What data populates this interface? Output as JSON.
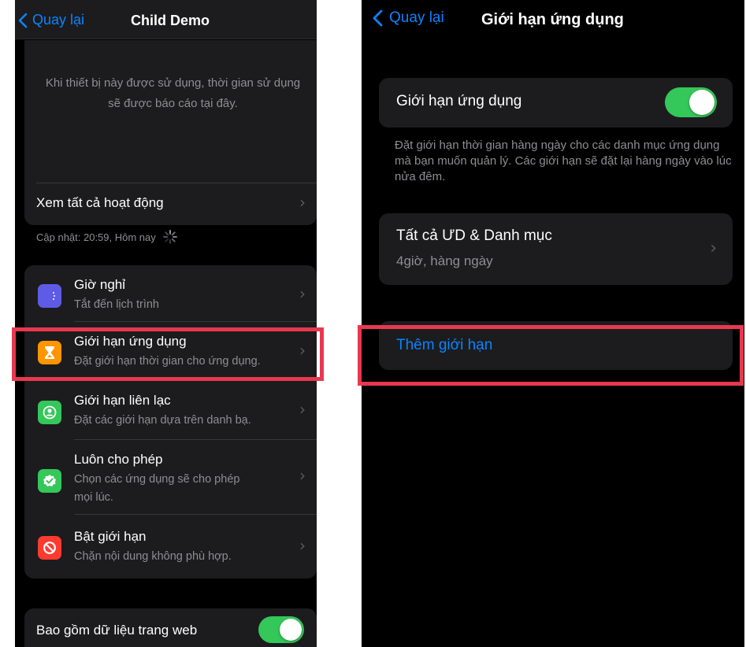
{
  "left_screen": {
    "nav": {
      "back_label": "Quay lại",
      "title": "Child Demo"
    },
    "usage_notice": "Khi thiết bị này được sử dụng, thời gian sử dụng sẽ được báo cáo tại đây.",
    "see_all_activity": "Xem tất cả hoạt động",
    "updated_text": "Cập nhật: 20:59, Hôm nay",
    "settings": [
      {
        "title": "Giờ nghỉ",
        "subtitle": "Tắt đến lịch trình",
        "icon": "downtime-icon",
        "color": "#5e5ce6"
      },
      {
        "title": "Giới hạn ứng dụng",
        "subtitle": "Đặt giới hạn thời gian cho ứng dụng.",
        "icon": "hourglass-icon",
        "color": "#ff9500"
      },
      {
        "title": "Giới hạn liên lạc",
        "subtitle": "Đặt các giới hạn dựa trên danh bạ.",
        "icon": "contact-icon",
        "color": "#34c759"
      },
      {
        "title": "Luôn cho phép",
        "subtitle_line1": "Chọn các ứng dụng sẽ cho phép",
        "subtitle_line2": "mọi lúc.",
        "icon": "checkmark-badge-icon",
        "color": "#34c759"
      },
      {
        "title": "Bật giới hạn",
        "subtitle": "Chặn nội dung không phù hợp.",
        "icon": "restriction-icon",
        "color": "#ff3b30"
      }
    ],
    "web_data": {
      "label": "Bao gồm dữ liệu trang web",
      "enabled": true
    }
  },
  "right_screen": {
    "nav": {
      "back_label": "Quay lại",
      "title": "Giới hạn ứng dụng"
    },
    "app_limits_toggle": {
      "label": "Giới hạn ứng dụng",
      "enabled": true
    },
    "description": "Đặt giới hạn thời gian hàng ngày cho các danh mục ứng dụng mà bạn muốn quản lý. Các giới hạn sẽ đặt lại hàng ngày vào lúc nửa đêm.",
    "limit_item": {
      "title": "Tất cả ƯD & Danh mục",
      "subtitle": "4giờ, hàng ngày"
    },
    "add_limit": "Thêm giới hạn"
  },
  "colors": {
    "accent_blue": "#0a84ff",
    "toggle_green": "#34c759",
    "highlight_red": "#e8384f"
  }
}
